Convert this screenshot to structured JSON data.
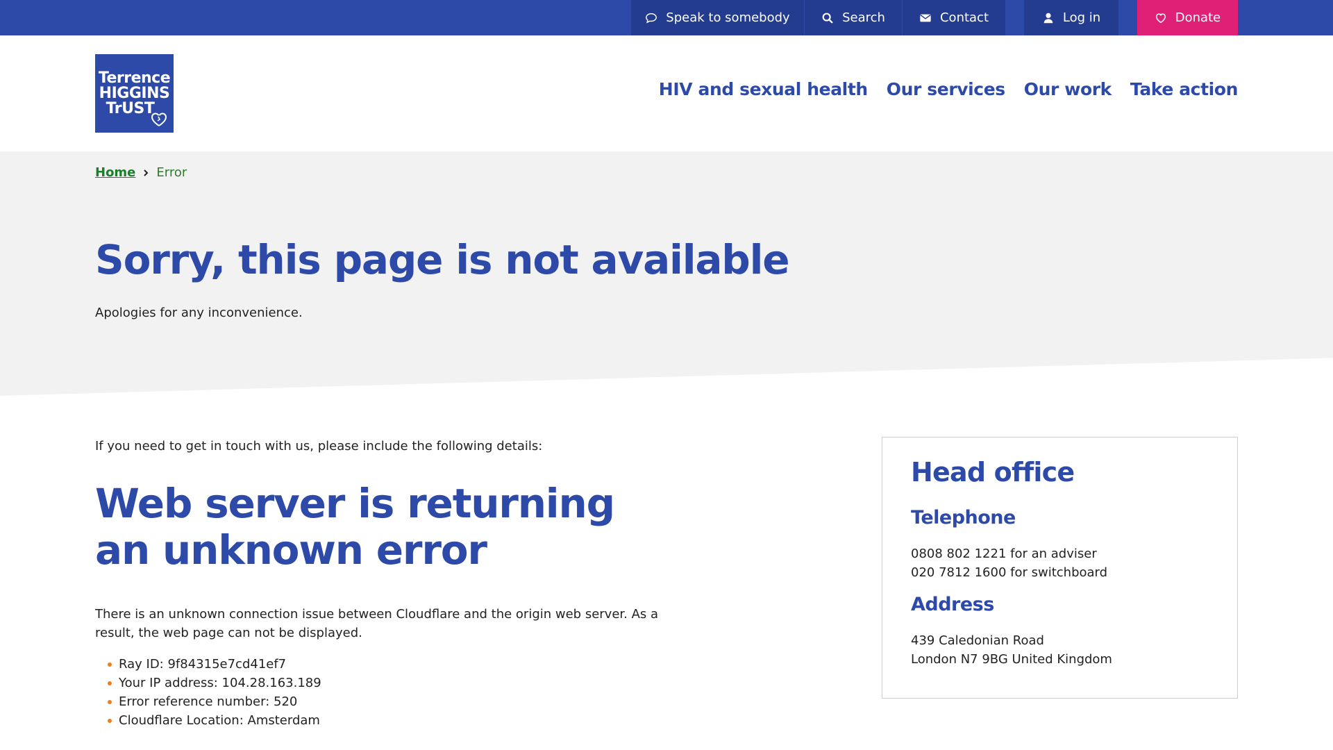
{
  "topbar": {
    "speak_label": "Speak to somebody",
    "search_label": "Search",
    "contact_label": "Contact",
    "login_label": "Log in",
    "donate_label": "Donate"
  },
  "logo": {
    "line1": "Terrence",
    "line2": "HIGGINS",
    "line3": "TrUST"
  },
  "nav": {
    "items": [
      "HIV and sexual health",
      "Our services",
      "Our work",
      "Take action"
    ]
  },
  "breadcrumb": {
    "home": "Home",
    "current": "Error"
  },
  "hero": {
    "title": "Sorry, this page is not available",
    "subtitle": "Apologies for any inconvenience."
  },
  "content": {
    "intro": "If you need to get in touch with us, please include the following details:",
    "error_title": "Web server is returning an unknown error",
    "description": "There is an unknown connection issue between Cloudflare and the origin web server. As a result, the web page can not be displayed.",
    "details": [
      "Ray ID: 9f84315e7cd41ef7",
      "Your IP address: 104.28.163.189",
      "Error reference number: 520",
      "Cloudflare Location: Amsterdam"
    ]
  },
  "office": {
    "title": "Head office",
    "telephone_heading": "Telephone",
    "telephone_lines": [
      "0808 802 1221 for an adviser",
      "020 7812 1600 for switchboard"
    ],
    "address_heading": "Address",
    "address_lines": [
      "439 Caledonian Road",
      "London N7 9BG United Kingdom"
    ]
  },
  "colors": {
    "brand_blue": "#2e4aa8",
    "topbar_dark": "#233c8f",
    "donate_pink": "#e01f77",
    "breadcrumb_green": "#1a7f2b",
    "bullet_orange": "#ef7d1a",
    "hero_grey": "#f2f2f2"
  },
  "icons": {
    "speak": "speech-bubble-icon",
    "search": "magnifier-icon",
    "contact": "envelope-icon",
    "login": "user-icon",
    "donate": "heart-icon",
    "breadcrumb_separator": "chevron-right-icon"
  }
}
